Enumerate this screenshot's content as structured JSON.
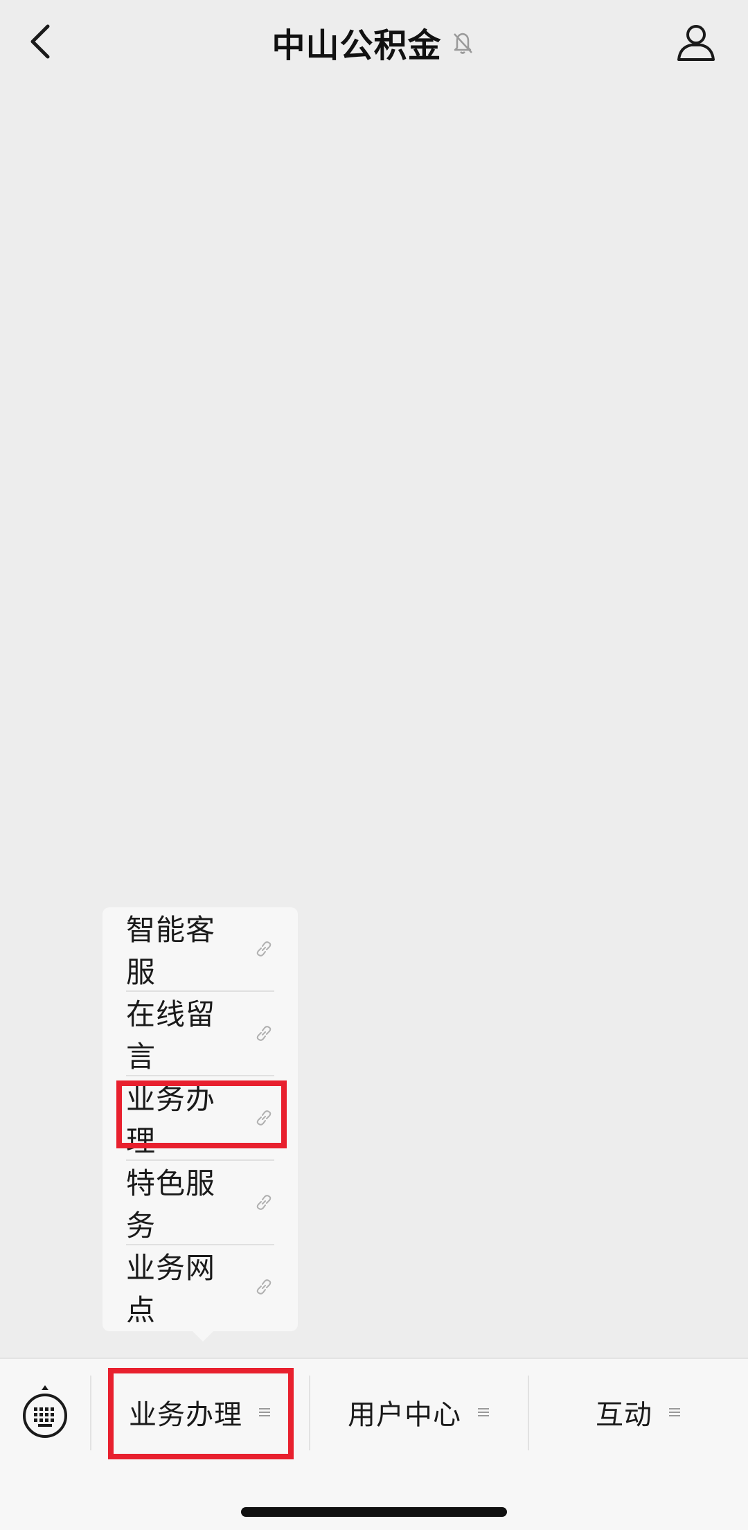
{
  "nav": {
    "title": "中山公积金",
    "back_icon": "chevron-left-icon",
    "mute_icon": "bell-muted-icon",
    "profile_icon": "person-icon"
  },
  "popup_menu": {
    "items": [
      {
        "label": "智能客服",
        "icon": "link-icon"
      },
      {
        "label": "在线留言",
        "icon": "link-icon"
      },
      {
        "label": "业务办理",
        "icon": "link-icon"
      },
      {
        "label": "特色服务",
        "icon": "link-icon"
      },
      {
        "label": "业务网点",
        "icon": "link-icon"
      }
    ]
  },
  "bottom_menu": {
    "keyboard_icon": "keyboard-toggle-icon",
    "tabs": [
      {
        "label": "业务办理",
        "icon": "menu-lines-icon"
      },
      {
        "label": "用户中心",
        "icon": "menu-lines-icon"
      },
      {
        "label": "互动",
        "icon": "menu-lines-icon"
      }
    ]
  },
  "colors": {
    "background": "#ededed",
    "bar_background": "#f7f7f7",
    "highlight": "#e8202e",
    "text": "#1a1a1a"
  }
}
